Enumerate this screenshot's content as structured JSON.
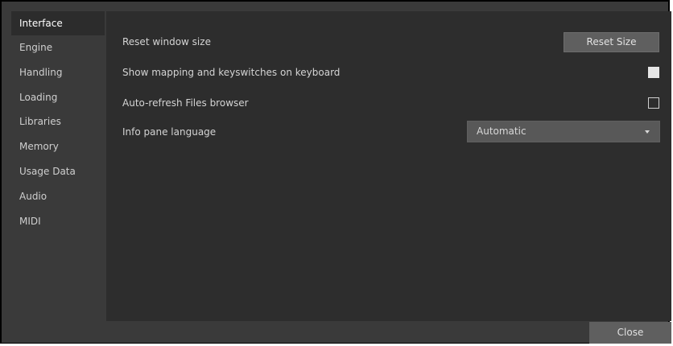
{
  "sidebar": {
    "items": [
      {
        "label": "Interface",
        "active": true
      },
      {
        "label": "Engine"
      },
      {
        "label": "Handling"
      },
      {
        "label": "Loading"
      },
      {
        "label": "Libraries"
      },
      {
        "label": "Memory"
      },
      {
        "label": "Usage Data"
      },
      {
        "label": "Audio"
      },
      {
        "label": "MIDI"
      }
    ]
  },
  "settings": {
    "reset_window_label": "Reset window size",
    "reset_button_label": "Reset Size",
    "show_mapping_label": "Show mapping and keyswitches on keyboard",
    "show_mapping_checked": true,
    "auto_refresh_label": "Auto-refresh Files browser",
    "auto_refresh_checked": false,
    "info_pane_label": "Info pane language",
    "info_pane_value": "Automatic"
  },
  "footer": {
    "close_label": "Close"
  },
  "colors": {
    "frame_bg": "#3a3a3a",
    "content_bg": "#2d2d2d",
    "button_bg": "#5f5f5f",
    "text": "#d4d4d4"
  },
  "icons": {
    "dropdown": "chevron-down-icon"
  }
}
